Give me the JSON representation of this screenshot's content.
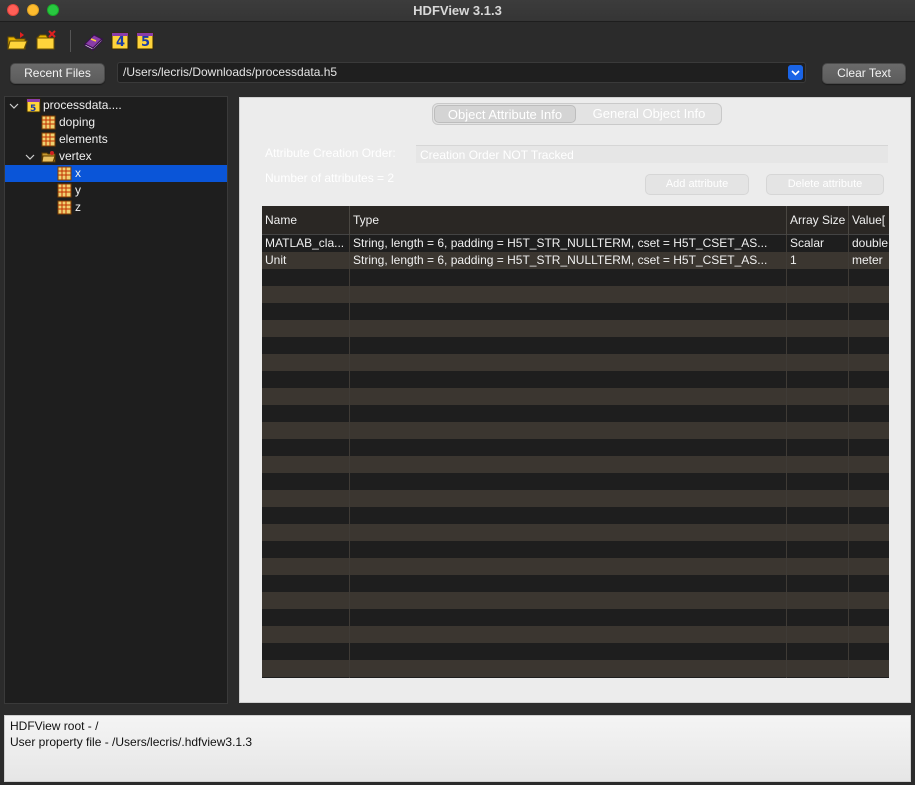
{
  "window": {
    "title": "HDFView 3.1.3"
  },
  "toolbar": {
    "icons": [
      "open-file-icon",
      "close-file-icon",
      "help-book-icon",
      "hdf4-library-icon",
      "hdf5-library-icon"
    ]
  },
  "file_row": {
    "recent_label": "Recent Files",
    "path": "/Users/lecris/Downloads/processdata.h5",
    "clear_label": "Clear Text"
  },
  "tree": {
    "root": "processdata....",
    "items": [
      {
        "label": "doping"
      },
      {
        "label": "elements"
      },
      {
        "label": "vertex"
      },
      {
        "label": "x"
      },
      {
        "label": "y"
      },
      {
        "label": "z"
      }
    ]
  },
  "info": {
    "tabs": [
      "Object Attribute Info",
      "General Object Info"
    ],
    "order_label": "Attribute Creation Order:",
    "order_value": "Creation Order NOT Tracked",
    "count_label": "Number of attributes = 2",
    "add_label": "Add attribute",
    "delete_label": "Delete attribute"
  },
  "table": {
    "columns": [
      "Name",
      "Type",
      "Array Size",
      "Value["
    ],
    "rows": [
      [
        "MATLAB_cla...",
        "String, length = 6, padding = H5T_STR_NULLTERM, cset = H5T_CSET_AS...",
        "Scalar",
        "double"
      ],
      [
        "Unit",
        "String, length = 6, padding = H5T_STR_NULLTERM, cset = H5T_CSET_AS...",
        "1",
        "meter"
      ]
    ]
  },
  "status": {
    "line1": "HDFView root - /",
    "line2": "User property file - /Users/lecris/.hdfview3.1.3"
  },
  "colors": {
    "selection": "#0a55d8",
    "dropdown_accent": "#1a64e6"
  }
}
